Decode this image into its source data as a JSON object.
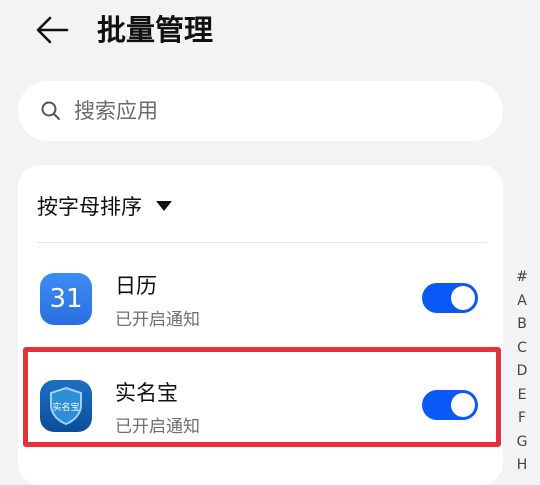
{
  "header": {
    "title": "批量管理"
  },
  "search": {
    "placeholder": "搜索应用"
  },
  "sort": {
    "label": "按字母排序"
  },
  "apps": [
    {
      "name": "日历",
      "status": "已开启通知",
      "icon_text": "31",
      "icon": "calendar-icon",
      "enabled": true
    },
    {
      "name": "实名宝",
      "status": "已开启通知",
      "icon_text": "实名宝",
      "icon": "shield-icon",
      "enabled": true
    }
  ],
  "alphabet": [
    "#",
    "A",
    "B",
    "C",
    "D",
    "E",
    "F",
    "G",
    "H"
  ],
  "colors": {
    "toggle_on": "#0a59f7",
    "highlight": "#e3323a",
    "background": "#f1f3f5"
  }
}
